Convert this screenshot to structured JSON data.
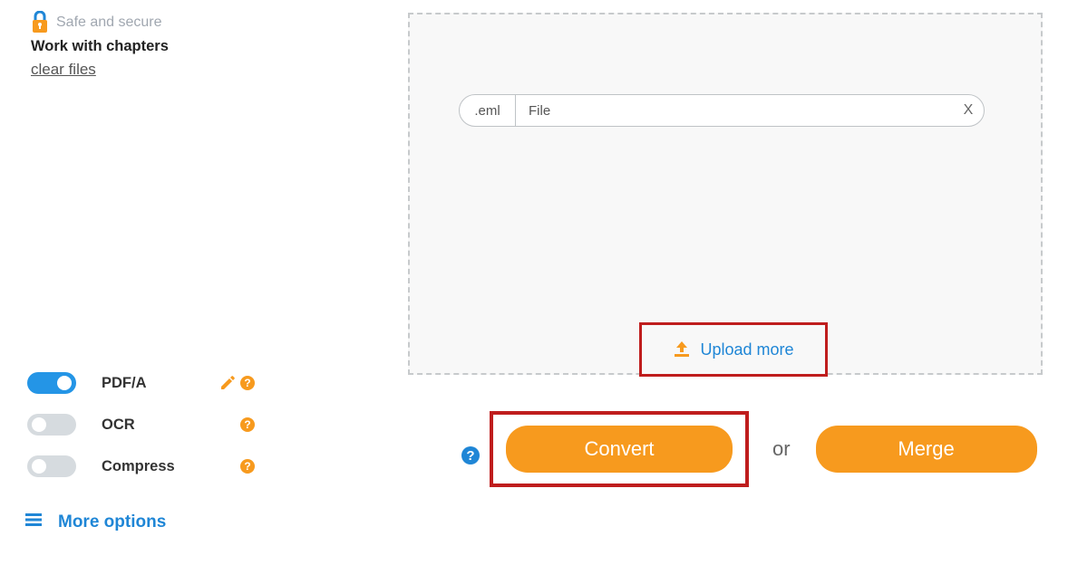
{
  "left": {
    "safe": "Safe and secure",
    "chapters": "Work with chapters",
    "clear": "clear files"
  },
  "toggles": {
    "pdfa": {
      "label": "PDF/A",
      "on": true,
      "edit": true,
      "help": true
    },
    "ocr": {
      "label": "OCR",
      "on": false,
      "edit": false,
      "help": true
    },
    "compress": {
      "label": "Compress",
      "on": false,
      "edit": false,
      "help": true
    }
  },
  "more_options": "More options",
  "file": {
    "ext": ".eml",
    "name": "File",
    "remove": "X"
  },
  "upload_more": "Upload more",
  "actions": {
    "convert": "Convert",
    "or": "or",
    "merge": "Merge"
  }
}
